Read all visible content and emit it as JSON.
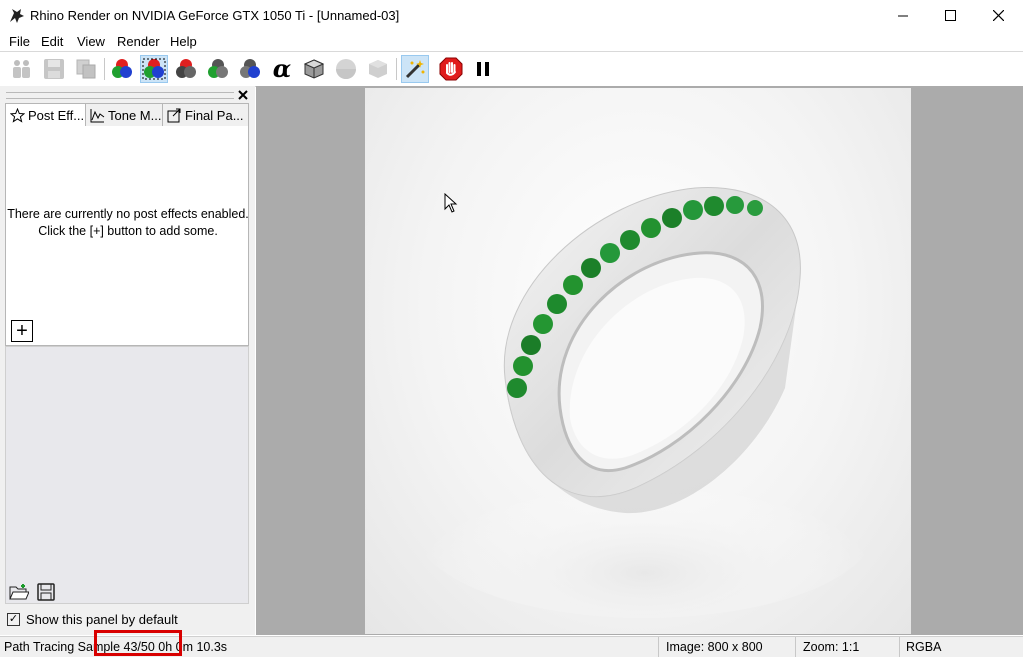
{
  "window": {
    "title": "Rhino Render on NVIDIA GeForce GTX 1050 Ti - [Unnamed-03]",
    "icon": "rhino-icon",
    "controls": [
      "minimize-icon",
      "maximize-icon",
      "close-icon"
    ]
  },
  "menu": {
    "items": [
      "File",
      "Edit",
      "View",
      "Render",
      "Help"
    ]
  },
  "toolbar": {
    "buttons": [
      {
        "name": "clone-render-window",
        "icon": "clone-icon",
        "enabled": false
      },
      {
        "name": "save-render",
        "icon": "save-icon",
        "enabled": false
      },
      {
        "name": "copy-render",
        "icon": "copy-icon",
        "enabled": false
      },
      {
        "name": "rgb-channel",
        "icon": "rgb-spheres-icon",
        "enabled": true
      },
      {
        "name": "rgb-channel-selected",
        "icon": "rgb-spheres-selected-icon",
        "enabled": true,
        "selected": true
      },
      {
        "name": "red-channel",
        "icon": "red-channel-icon",
        "enabled": true
      },
      {
        "name": "green-channel",
        "icon": "green-channel-icon",
        "enabled": true
      },
      {
        "name": "blue-channel",
        "icon": "blue-channel-icon",
        "enabled": true
      },
      {
        "name": "alpha-channel",
        "icon": "alpha-icon",
        "enabled": true
      },
      {
        "name": "depth-channel",
        "icon": "gray-cube-icon",
        "enabled": true
      },
      {
        "name": "normal-channel",
        "icon": "gray-sphere-icon",
        "enabled": false
      },
      {
        "name": "object-channel",
        "icon": "gray-box-icon",
        "enabled": false
      },
      {
        "name": "post-effects-toggle",
        "icon": "magic-wand-icon",
        "enabled": true,
        "selected": true
      },
      {
        "name": "stop-render",
        "icon": "stop-hand-icon",
        "enabled": true
      },
      {
        "name": "pause-render",
        "icon": "pause-icon",
        "enabled": true
      }
    ],
    "colors": {
      "selected_bg": "#cce4f7",
      "stop_red": "#e01b1b"
    }
  },
  "panel": {
    "tabs": [
      {
        "label": "Post Eff...",
        "icon": "star-icon",
        "active": true
      },
      {
        "label": "Tone M...",
        "icon": "tone-curve-icon",
        "active": false
      },
      {
        "label": "Final Pa...",
        "icon": "final-pass-icon",
        "active": false
      }
    ],
    "empty_message_line1": "There are currently no post effects enabled.",
    "empty_message_line2": "Click the [+] button to add some.",
    "add_button": "+",
    "bottom_icons": [
      "open-folder-icon",
      "save-icon"
    ],
    "show_by_default": {
      "label": "Show this panel by default",
      "checked": true
    }
  },
  "statusbar": {
    "progress_text": "Path Tracing Sample 43/50 0h 0m 10.3s",
    "image_size": "Image: 800 x 800",
    "zoom": "Zoom: 1:1",
    "channel": "RGBA"
  },
  "render": {
    "subject": "silver ring with green gemstones",
    "gem_color": "#1f8a2e",
    "metal_color": "#e4e4e4"
  }
}
